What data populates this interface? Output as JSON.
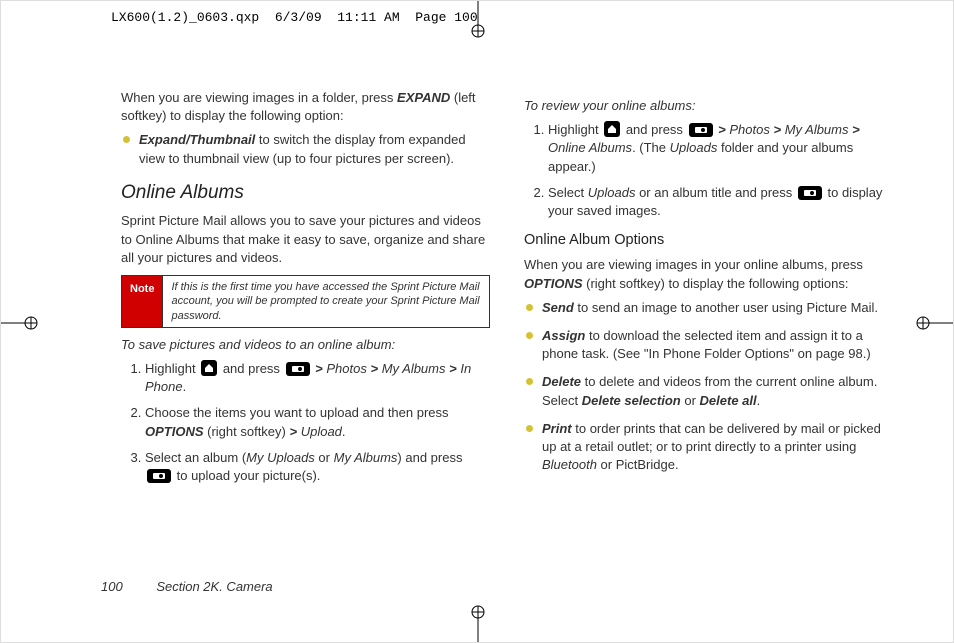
{
  "job_header": "LX600(1.2)_0603.qxp  6/3/09  11:11 AM  Page 100",
  "left": {
    "intro_p1a": "When you are viewing images in a folder, press ",
    "intro_p1b": "EXPAND",
    "intro_p1c": " (left softkey) to display the following option:",
    "b1_a": "Expand/Thumbnail",
    "b1_b": " to switch the display from expanded view to thumbnail view (up to four pictures per screen).",
    "h1": "Online Albums",
    "sprint_p": "Sprint Picture Mail allows you to save your pictures and videos to Online Albums that make it easy to save, organize and share all your pictures and videos.",
    "note_label": "Note",
    "note_body": "If this is the first time you have accessed the Sprint Picture Mail account, you will be prompted to create your Sprint  Picture Mail password.",
    "instr1": "To save pictures and videos to an online album:",
    "o1_a": "Highlight ",
    "o1_b": " and press ",
    "o1_c": " > ",
    "o1_photos": "Photos",
    "o1_myalbums": "My Albums",
    "o1_inphone": "In Phone",
    "o1_end": ".",
    "o2_a": "Choose the items you want to upload and then press ",
    "o2_options": "OPTIONS",
    "o2_b": " (right softkey) ",
    "o2_upload": "Upload",
    "o2_end": ".",
    "o3_a": "Select an album (",
    "o3_mu": "My Uploads",
    "o3_or": " or ",
    "o3_ma": "My Albums",
    "o3_b": ") and press ",
    "o3_c": " to upload your picture(s)."
  },
  "right": {
    "instr2": "To review your online albums:",
    "r1_a": "Highlight ",
    "r1_b": " and press ",
    "r1_c": " > ",
    "r1_photos": "Photos",
    "r1_myalbums": "My Albums",
    "r1_online": "Online Albums",
    "r1_d": ". (The ",
    "r1_uploads": "Uploads",
    "r1_e": " folder and your albums appear.)",
    "r2_a": "Select ",
    "r2_uploads": "Uploads",
    "r2_b": " or an album title and press ",
    "r2_c": " to display your saved images.",
    "h2": "Online Album Options",
    "oao_intro_a": "When you are viewing images in your online albums, press ",
    "oao_intro_options": "OPTIONS",
    "oao_intro_b": " (right softkey) to display the following options:",
    "s_send": "Send",
    "s_send_b": " to send an image to another user using Picture Mail.",
    "s_assign": "Assign",
    "s_assign_b": " to download the selected item and assign it to a phone task. (See \"In Phone Folder Options\" on page 98.)",
    "s_delete": "Delete",
    "s_delete_b": " to delete and videos from the current online album. Select ",
    "s_delete_sel": "Delete selection",
    "s_delete_or": " or ",
    "s_delete_all": "Delete all",
    "s_delete_end": ".",
    "s_print": "Print",
    "s_print_b": " to order prints that can be delivered by mail or picked up at a retail outlet; or to print directly to a printer using ",
    "s_print_bt": "Bluetooth",
    "s_print_c": " or PictBridge."
  },
  "footer": {
    "page_num": "100",
    "section": "Section 2K. Camera"
  }
}
